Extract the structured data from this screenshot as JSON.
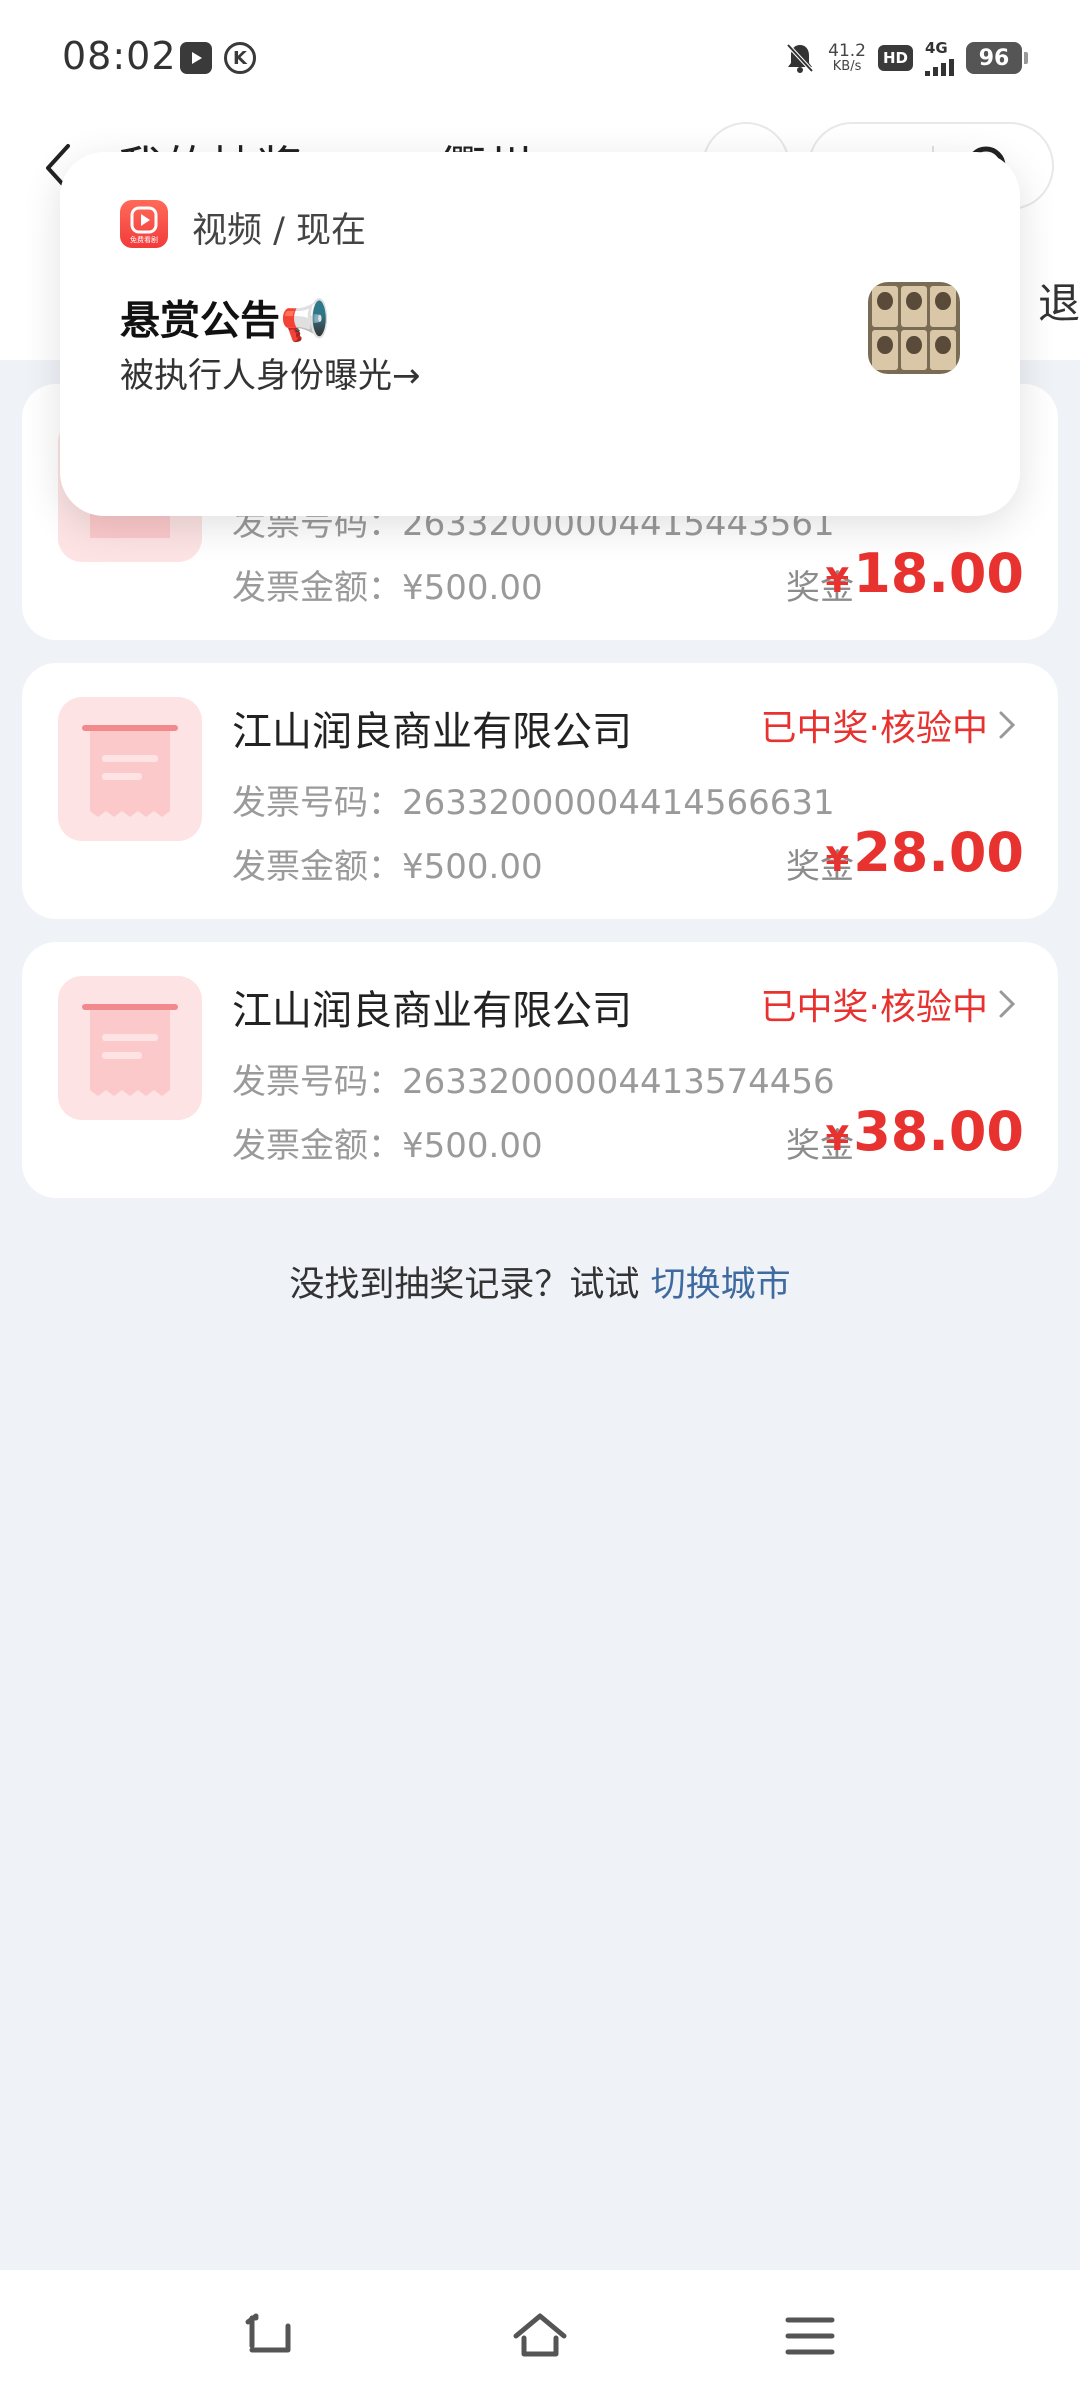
{
  "status_bar": {
    "time": "08:02",
    "speed_value": "41.2",
    "speed_unit": "KB/s",
    "hd": "HD",
    "network": "4G",
    "battery": "96"
  },
  "header": {
    "title_left": "我的抽奖",
    "title_right": "衢州",
    "tab_edge": "退"
  },
  "notification": {
    "source": "视频 / 现在",
    "title": "悬赏公告📢",
    "body": "被执行人身份曝光→",
    "app_icon_caption": "免费看剧"
  },
  "records": [
    {
      "company": "",
      "status": "",
      "invoice_label": "发票号码：",
      "invoice_no": "26332000004415443561",
      "amount_label": "发票金额：",
      "amount": "¥500.00",
      "prize_label": "奖金",
      "prize_currency": "¥",
      "prize": "18.00"
    },
    {
      "company": "江山润良商业有限公司",
      "status": "已中奖·核验中",
      "invoice_label": "发票号码：",
      "invoice_no": "26332000004414566631",
      "amount_label": "发票金额：",
      "amount": "¥500.00",
      "prize_label": "奖金",
      "prize_currency": "¥",
      "prize": "28.00"
    },
    {
      "company": "江山润良商业有限公司",
      "status": "已中奖·核验中",
      "invoice_label": "发票号码：",
      "invoice_no": "26332000004413574456",
      "amount_label": "发票金额：",
      "amount": "¥500.00",
      "prize_label": "奖金",
      "prize_currency": "¥",
      "prize": "38.00"
    }
  ],
  "footer": {
    "prompt": "没找到抽奖记录？试试 ",
    "link": "切换城市"
  },
  "colors": {
    "accent_red": "#e8322f",
    "link_blue": "#3e6aa0",
    "background": "#eff2f7"
  }
}
